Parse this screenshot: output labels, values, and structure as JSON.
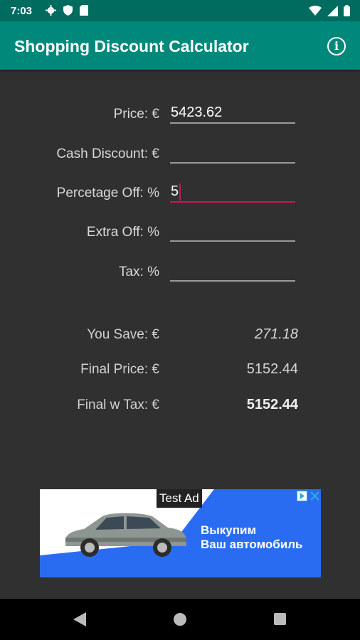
{
  "status_bar": {
    "time": "7:03"
  },
  "app_bar": {
    "title": "Shopping Discount Calculator"
  },
  "form": {
    "price": {
      "label": "Price: €",
      "value": "5423.62"
    },
    "cash_discount": {
      "label": "Cash Discount: €",
      "value": ""
    },
    "percentage_off": {
      "label": "Percetage Off: %",
      "value": "5"
    },
    "extra_off": {
      "label": "Extra Off: %",
      "value": ""
    },
    "tax": {
      "label": "Tax:  %",
      "value": ""
    }
  },
  "results": {
    "you_save": {
      "label": "You Save: €",
      "value": "271.18"
    },
    "final_price": {
      "label": "Final Price: €",
      "value": "5152.44"
    },
    "final_with_tax": {
      "label": "Final w Tax: €",
      "value": "5152.44"
    }
  },
  "ad": {
    "badge": "Test Ad",
    "line1": "Выкупим",
    "line2": "Ваш автомобиль"
  },
  "colors": {
    "accent": "#00897b",
    "status_bar": "#006b5f",
    "focus": "#c2185b",
    "background": "#303030"
  }
}
